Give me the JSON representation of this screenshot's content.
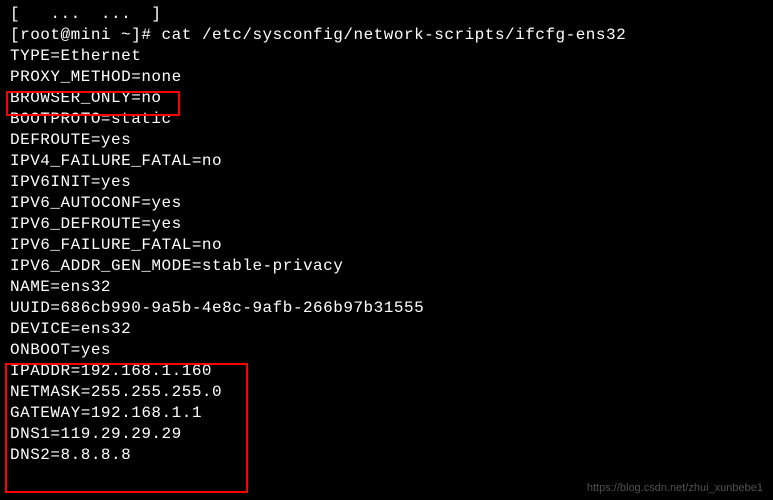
{
  "terminal": {
    "truncated_line": "[   ...  ...  ]",
    "prompt": "[root@mini ~]# ",
    "command": "cat /etc/sysconfig/network-scripts/ifcfg-ens32",
    "lines": [
      "TYPE=Ethernet",
      "PROXY_METHOD=none",
      "BROWSER_ONLY=no",
      "BOOTPROTO=static",
      "DEFROUTE=yes",
      "IPV4_FAILURE_FATAL=no",
      "IPV6INIT=yes",
      "IPV6_AUTOCONF=yes",
      "IPV6_DEFROUTE=yes",
      "IPV6_FAILURE_FATAL=no",
      "IPV6_ADDR_GEN_MODE=stable-privacy",
      "NAME=ens32",
      "UUID=686cb990-9a5b-4e8c-9afb-266b97b31555",
      "DEVICE=ens32",
      "ONBOOT=yes",
      "IPADDR=192.168.1.160",
      "NETMASK=255.255.255.0",
      "GATEWAY=192.168.1.1",
      "DNS1=119.29.29.29",
      "DNS2=8.8.8.8"
    ]
  },
  "watermark": "https://blog.csdn.net/zhui_xunbebe1"
}
